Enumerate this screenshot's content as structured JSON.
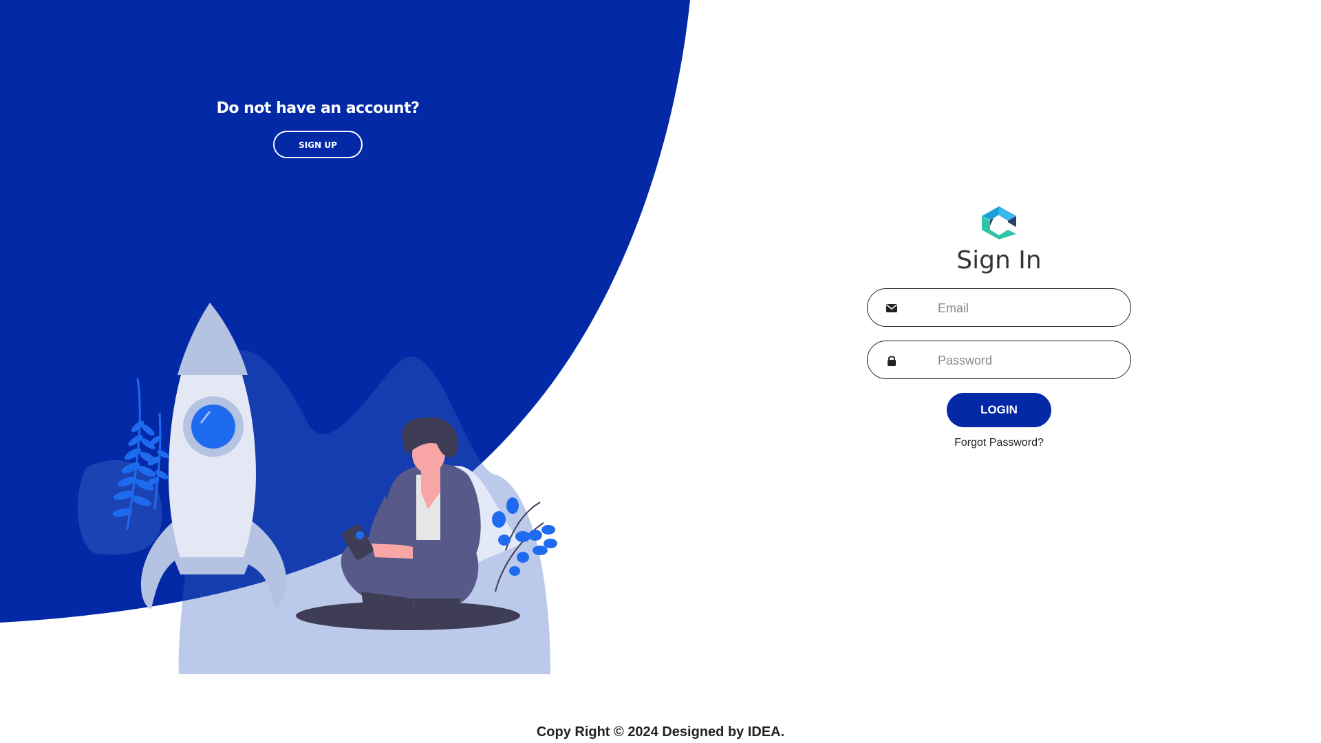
{
  "colors": {
    "brand_blue": "#0329a6",
    "accent_blue": "#1f6bf0",
    "white": "#ffffff"
  },
  "left_panel": {
    "heading": "Do not have an account?",
    "signup_label": "SIGN UP"
  },
  "signin": {
    "title": "Sign In",
    "email": {
      "placeholder": "Email",
      "value": "",
      "icon": "envelope-icon"
    },
    "password": {
      "placeholder": "Password",
      "value": "",
      "icon": "lock-icon"
    },
    "login_label": "LOGIN",
    "forgot_label": "Forgot Password?"
  },
  "footer": {
    "text": "Copy Right © 2024 Designed by IDEA."
  }
}
